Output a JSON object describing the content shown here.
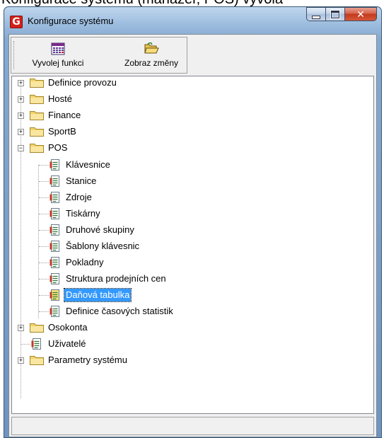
{
  "background_title": "Konfigurace systému (manažer, POS) vyvolá",
  "window": {
    "title": "Konfigurace systému",
    "icon": "app-icon-red-g",
    "app_icon_letter": "G",
    "close_glyph": "✕"
  },
  "toolbar": {
    "buttons": [
      {
        "label": "Vyvolej funkci",
        "icon": "calendar-grid-icon"
      },
      {
        "label": "Zobraz změny",
        "icon": "open-folder-icon"
      }
    ]
  },
  "tree": {
    "items": [
      {
        "label": "Definice provozu",
        "type": "folder",
        "expanded": false,
        "level": 0
      },
      {
        "label": "Hosté",
        "type": "folder",
        "expanded": false,
        "level": 0
      },
      {
        "label": "Finance",
        "type": "folder",
        "expanded": false,
        "level": 0
      },
      {
        "label": "SportB",
        "type": "folder",
        "expanded": false,
        "level": 0
      },
      {
        "label": "POS",
        "type": "folder",
        "expanded": true,
        "level": 0
      },
      {
        "label": "Klávesnice",
        "type": "document",
        "level": 1
      },
      {
        "label": "Stanice",
        "type": "document",
        "level": 1
      },
      {
        "label": "Zdroje",
        "type": "document",
        "level": 1
      },
      {
        "label": "Tiskárny",
        "type": "document",
        "level": 1
      },
      {
        "label": "Druhové skupiny",
        "type": "document",
        "level": 1
      },
      {
        "label": "Šablony klávesnic",
        "type": "document",
        "level": 1
      },
      {
        "label": "Pokladny",
        "type": "document",
        "level": 1
      },
      {
        "label": "Struktura prodejních cen",
        "type": "document",
        "level": 1
      },
      {
        "label": "Daňová tabulka",
        "type": "document",
        "level": 1,
        "selected": true
      },
      {
        "label": "Definice časových statistik",
        "type": "document",
        "level": 1
      },
      {
        "label": "Osokonta",
        "type": "folder",
        "expanded": false,
        "level": 0
      },
      {
        "label": "Uživatelé",
        "type": "document",
        "level": 0
      },
      {
        "label": "Parametry systému",
        "type": "folder",
        "expanded": false,
        "level": 0
      }
    ]
  },
  "status": "",
  "colors": {
    "selection": "#3399ff",
    "folder": "#f3d46a",
    "close_button": "#c23a1d"
  }
}
